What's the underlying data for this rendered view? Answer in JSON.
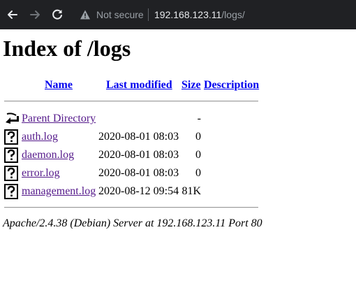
{
  "browser": {
    "security_label": "Not secure",
    "url_host": "192.168.123.11",
    "url_path": "/logs/"
  },
  "page": {
    "title": "Index of /logs",
    "columns": {
      "name": "Name",
      "last_modified": "Last modified",
      "size": "Size",
      "description": "Description"
    },
    "parent": {
      "name": "Parent Directory",
      "size": "-"
    },
    "files": [
      {
        "name": "auth.log",
        "modified": "2020-08-01 08:03",
        "size": "0"
      },
      {
        "name": "daemon.log",
        "modified": "2020-08-01 08:03",
        "size": "0"
      },
      {
        "name": "error.log",
        "modified": "2020-08-01 08:03",
        "size": "0"
      },
      {
        "name": "management.log",
        "modified": "2020-08-12 09:54",
        "size": "81K"
      }
    ],
    "footer": "Apache/2.4.38 (Debian) Server at 192.168.123.11 Port 80"
  },
  "colors": {
    "toolbar_bg": "#202124",
    "visited_link": "#551a8b",
    "link": "#0000ee"
  },
  "icons": {
    "back": "arrow-left-icon",
    "forward": "arrow-right-icon",
    "reload": "reload-icon",
    "warning": "warning-triangle-icon",
    "parent": "folder-back-icon",
    "file": "unknown-file-icon"
  }
}
